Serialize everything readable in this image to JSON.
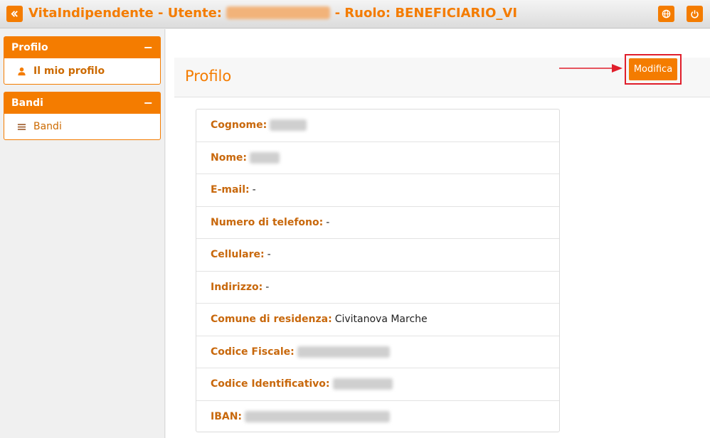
{
  "topbar": {
    "title_prefix": "VitaIndipendente - Utente:",
    "title_suffix": "- Ruolo: BENEFICIARIO_VI",
    "icons": [
      "double-chevron-left-icon",
      "globe-icon",
      "power-icon"
    ]
  },
  "sidebar": {
    "panels": [
      {
        "title": "Profilo",
        "collapse_symbol": "−",
        "items": [
          {
            "label": "Il mio profilo",
            "icon": "user-icon"
          }
        ]
      },
      {
        "title": "Bandi",
        "collapse_symbol": "−",
        "items": [
          {
            "label": "Bandi",
            "icon": "list-icon"
          }
        ]
      }
    ]
  },
  "main": {
    "page_title": "Profilo",
    "modifica_label": "Modifica",
    "fields": [
      {
        "label": "Cognome:",
        "value": "",
        "redacted": true
      },
      {
        "label": "Nome:",
        "value": "",
        "redacted": true
      },
      {
        "label": "E-mail:",
        "value": "-"
      },
      {
        "label": "Numero di telefono:",
        "value": "-"
      },
      {
        "label": "Cellulare:",
        "value": "-"
      },
      {
        "label": "Indirizzo:",
        "value": "-"
      },
      {
        "label": "Comune di residenza:",
        "value": "Civitanova Marche"
      },
      {
        "label": "Codice Fiscale:",
        "value": "",
        "redacted": true
      },
      {
        "label": "Codice Identificativo:",
        "value": "",
        "redacted": true
      },
      {
        "label": "IBAN:",
        "value": "",
        "redacted": true
      }
    ]
  },
  "colors": {
    "accent": "#f47c00",
    "label": "#c8680c",
    "highlight": "#e01e2b"
  }
}
